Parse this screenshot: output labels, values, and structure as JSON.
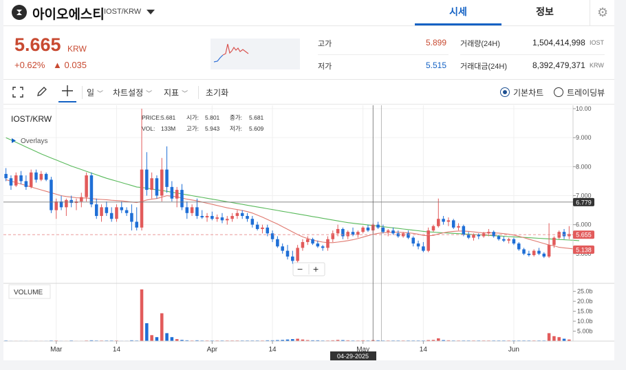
{
  "header": {
    "coin_name": "아이오에스티",
    "coin_pair": "IOST/KRW",
    "tabs": [
      "시세",
      "정보"
    ]
  },
  "summary": {
    "price": "5.665",
    "unit": "KRW",
    "change_rate": "+0.62%",
    "change_amount": "▲ 0.035",
    "high_label": "고가",
    "high": "5.899",
    "low_label": "저가",
    "low": "5.515",
    "volume_label": "거래량(24H)",
    "volume": "1,504,414,998",
    "volume_unit": "IOST",
    "value_label": "거래대금(24H)",
    "value": "8,392,479,371",
    "value_unit": "KRW"
  },
  "toolbar": {
    "period": "일",
    "chart_settings": "차트설정",
    "indicators": "지표",
    "reset": "초기화",
    "basic_chart": "기본차트",
    "trading_view": "트레이딩뷰"
  },
  "chart": {
    "symbol": "IOST/KRW",
    "overlays": "Overlays",
    "ohlc": {
      "price_label": "PRICE:",
      "price": "5.681",
      "open_label": "시가:",
      "open": "5.801",
      "close_label": "종가:",
      "close": "5.681",
      "vol_label": "VOL:",
      "vol": "133M",
      "high_label": "고가:",
      "high": "5.943",
      "low_label": "저가:",
      "low": "5.609"
    },
    "volume_title": "VOLUME",
    "cursor_date": "04-29-2025",
    "zoom_out": "−",
    "zoom_in": "+"
  },
  "chart_data": {
    "type": "candlestick",
    "x_ticks": [
      "Mar",
      "14",
      "Apr",
      "14",
      "May",
      "14",
      "Jun"
    ],
    "price_ticks": [
      10,
      9,
      8,
      7,
      6,
      5
    ],
    "price_tick_labels": [
      "10.00",
      "9.000",
      "8.000",
      "7.000",
      "6.000",
      "5.000"
    ],
    "volume_ticks": [
      25,
      20,
      15,
      10,
      5
    ],
    "volume_tick_labels": [
      "25.0b",
      "20.0b",
      "15.0b",
      "10.0b",
      "5.00b"
    ],
    "price_ylim": [
      4.0,
      10.0
    ],
    "volume_ylim": [
      0,
      28
    ],
    "price_markers": [
      {
        "label": "6.779",
        "value": 6.779,
        "color": "#333333"
      },
      {
        "label": "5.655",
        "value": 5.655,
        "color": "#e25b5b"
      },
      {
        "label": "5.138",
        "value": 5.138,
        "color": "#e25b5b"
      }
    ],
    "candles": [
      [
        7.75,
        7.95,
        7.5,
        7.6
      ],
      [
        7.6,
        7.7,
        7.2,
        7.35
      ],
      [
        7.35,
        7.8,
        7.3,
        7.7
      ],
      [
        7.7,
        7.85,
        7.4,
        7.5
      ],
      [
        7.5,
        7.7,
        7.2,
        7.3
      ],
      [
        7.3,
        7.9,
        7.25,
        7.8
      ],
      [
        7.8,
        7.9,
        7.45,
        7.55
      ],
      [
        7.55,
        7.85,
        7.5,
        7.75
      ],
      [
        7.75,
        7.8,
        7.5,
        7.55
      ],
      [
        7.55,
        7.65,
        6.4,
        6.5
      ],
      [
        6.5,
        6.9,
        6.2,
        6.8
      ],
      [
        6.8,
        7.0,
        6.5,
        6.6
      ],
      [
        6.6,
        6.9,
        6.3,
        6.85
      ],
      [
        6.85,
        7.0,
        6.6,
        6.75
      ],
      [
        6.75,
        6.9,
        6.5,
        6.8
      ],
      [
        6.8,
        7.1,
        6.6,
        6.95
      ],
      [
        6.95,
        7.8,
        6.8,
        7.7
      ],
      [
        7.7,
        7.8,
        6.6,
        6.7
      ],
      [
        6.7,
        6.9,
        6.2,
        6.3
      ],
      [
        6.3,
        6.7,
        6.1,
        6.6
      ],
      [
        6.6,
        6.8,
        6.3,
        6.4
      ],
      [
        6.4,
        6.6,
        6.1,
        6.2
      ],
      [
        6.2,
        6.7,
        6.1,
        6.6
      ],
      [
        6.6,
        6.8,
        6.4,
        6.5
      ],
      [
        6.5,
        6.6,
        6.3,
        6.4
      ],
      [
        6.4,
        6.7,
        5.8,
        6.1
      ],
      [
        6.1,
        6.6,
        5.8,
        5.9
      ],
      [
        5.9,
        10.0,
        5.8,
        7.9
      ],
      [
        7.9,
        8.5,
        7.0,
        7.2
      ],
      [
        7.2,
        7.8,
        6.9,
        7.6
      ],
      [
        7.6,
        7.7,
        6.9,
        7.0
      ],
      [
        7.0,
        8.3,
        6.8,
        7.9
      ],
      [
        7.9,
        8.7,
        7.1,
        7.3
      ],
      [
        7.3,
        7.5,
        6.8,
        6.9
      ],
      [
        6.9,
        7.3,
        6.6,
        7.2
      ],
      [
        7.2,
        7.4,
        6.5,
        6.6
      ],
      [
        6.6,
        6.8,
        6.2,
        6.4
      ],
      [
        6.4,
        6.7,
        6.3,
        6.6
      ],
      [
        6.6,
        6.9,
        6.2,
        6.3
      ],
      [
        6.3,
        6.5,
        6.2,
        6.25
      ],
      [
        6.25,
        6.4,
        6.1,
        6.3
      ],
      [
        6.3,
        6.45,
        6.15,
        6.2
      ],
      [
        6.2,
        6.35,
        6.1,
        6.25
      ],
      [
        6.25,
        6.4,
        6.05,
        6.15
      ],
      [
        6.15,
        6.3,
        6.0,
        6.2
      ],
      [
        6.2,
        6.4,
        6.1,
        6.3
      ],
      [
        6.3,
        6.5,
        6.2,
        6.4
      ],
      [
        6.4,
        6.5,
        6.2,
        6.3
      ],
      [
        6.3,
        6.4,
        6.1,
        6.2
      ],
      [
        6.2,
        6.3,
        5.9,
        6.0
      ],
      [
        6.0,
        6.1,
        5.8,
        5.85
      ],
      [
        5.85,
        6.0,
        5.7,
        5.9
      ],
      [
        5.9,
        6.0,
        5.6,
        5.7
      ],
      [
        5.7,
        5.8,
        5.4,
        5.5
      ],
      [
        5.5,
        5.6,
        5.2,
        5.25
      ],
      [
        5.25,
        5.35,
        5.0,
        5.1
      ],
      [
        5.1,
        5.3,
        4.8,
        4.9
      ],
      [
        4.9,
        5.1,
        4.65,
        4.75
      ],
      [
        4.75,
        5.3,
        4.7,
        5.2
      ],
      [
        5.2,
        5.5,
        5.1,
        5.4
      ],
      [
        5.4,
        5.6,
        5.3,
        5.5
      ],
      [
        5.5,
        5.55,
        5.3,
        5.35
      ],
      [
        5.35,
        5.45,
        5.2,
        5.25
      ],
      [
        5.25,
        5.3,
        5.1,
        5.2
      ],
      [
        5.2,
        5.6,
        5.1,
        5.5
      ],
      [
        5.5,
        5.8,
        5.4,
        5.7
      ],
      [
        5.7,
        6.0,
        5.6,
        5.85
      ],
      [
        5.85,
        5.9,
        5.5,
        5.6
      ],
      [
        5.6,
        5.8,
        5.5,
        5.75
      ],
      [
        5.75,
        5.9,
        5.6,
        5.65
      ],
      [
        5.65,
        5.8,
        5.55,
        5.75
      ],
      [
        5.75,
        5.95,
        5.7,
        5.9
      ],
      [
        5.9,
        6.0,
        5.75,
        5.8
      ],
      [
        5.8,
        6.05,
        5.7,
        6.0
      ],
      [
        6.0,
        6.1,
        5.85,
        5.9
      ],
      [
        5.9,
        6.0,
        5.7,
        5.75
      ],
      [
        5.75,
        5.85,
        5.6,
        5.8
      ],
      [
        5.8,
        5.9,
        5.65,
        5.7
      ],
      [
        5.7,
        5.8,
        5.55,
        5.6
      ],
      [
        5.6,
        5.75,
        5.55,
        5.7
      ],
      [
        5.7,
        5.8,
        5.5,
        5.55
      ],
      [
        5.55,
        5.6,
        5.25,
        5.35
      ],
      [
        5.35,
        5.45,
        5.15,
        5.25
      ],
      [
        5.25,
        5.4,
        5.05,
        5.1
      ],
      [
        5.1,
        5.9,
        5.05,
        5.8
      ],
      [
        5.8,
        6.0,
        5.75,
        5.95
      ],
      [
        5.95,
        6.9,
        5.9,
        6.2
      ],
      [
        6.2,
        6.3,
        6.0,
        6.1
      ],
      [
        6.1,
        6.25,
        5.95,
        6.15
      ],
      [
        6.15,
        6.2,
        5.85,
        5.9
      ],
      [
        5.9,
        6.05,
        5.8,
        5.95
      ],
      [
        5.95,
        6.0,
        5.6,
        5.65
      ],
      [
        5.65,
        5.75,
        5.5,
        5.55
      ],
      [
        5.55,
        5.7,
        5.45,
        5.65
      ],
      [
        5.65,
        5.7,
        5.5,
        5.6
      ],
      [
        5.6,
        5.75,
        5.55,
        5.7
      ],
      [
        5.7,
        5.85,
        5.6,
        5.75
      ],
      [
        5.75,
        5.8,
        5.55,
        5.6
      ],
      [
        5.6,
        5.65,
        5.45,
        5.5
      ],
      [
        5.5,
        5.6,
        5.4,
        5.45
      ],
      [
        5.45,
        5.55,
        5.35,
        5.5
      ],
      [
        5.5,
        5.55,
        5.3,
        5.35
      ],
      [
        5.35,
        5.4,
        5.1,
        5.15
      ],
      [
        5.15,
        5.2,
        4.95,
        5.0
      ],
      [
        5.0,
        5.1,
        4.9,
        4.95
      ],
      [
        4.95,
        5.15,
        4.9,
        5.1
      ],
      [
        5.1,
        5.2,
        4.95,
        5.0
      ],
      [
        5.0,
        5.05,
        4.85,
        4.9
      ],
      [
        4.9,
        6.05,
        4.85,
        5.3
      ],
      [
        5.3,
        5.6,
        5.2,
        5.55
      ],
      [
        5.55,
        5.8,
        5.5,
        5.75
      ],
      [
        5.75,
        5.85,
        5.5,
        5.6
      ],
      [
        5.6,
        5.95,
        5.5,
        5.68
      ]
    ],
    "volumes": [
      0.3,
      0.2,
      0.2,
      0.2,
      0.2,
      0.2,
      0.2,
      0.2,
      0.2,
      0.3,
      0.3,
      0.2,
      0.2,
      0.3,
      0.2,
      0.2,
      0.3,
      0.4,
      0.3,
      0.3,
      0.3,
      0.3,
      0.3,
      0.2,
      0.2,
      0.4,
      0.3,
      26.0,
      9.0,
      3.0,
      2.0,
      14.0,
      4.0,
      2.0,
      1.0,
      0.6,
      0.4,
      0.3,
      0.4,
      0.3,
      0.3,
      0.3,
      0.3,
      0.3,
      0.3,
      0.3,
      0.3,
      0.3,
      0.3,
      0.3,
      0.3,
      0.3,
      0.4,
      0.4,
      0.5,
      0.6,
      0.8,
      1.0,
      1.2,
      0.8,
      0.5,
      0.4,
      0.4,
      0.3,
      0.3,
      0.4,
      0.6,
      0.5,
      0.4,
      0.3,
      0.3,
      0.4,
      0.3,
      0.5,
      0.4,
      0.3,
      0.3,
      0.3,
      0.3,
      0.3,
      0.3,
      0.3,
      0.3,
      0.3,
      0.5,
      0.6,
      1.4,
      0.5,
      0.4,
      0.3,
      0.3,
      0.3,
      0.3,
      0.3,
      0.3,
      0.3,
      0.3,
      0.3,
      0.3,
      0.3,
      0.3,
      0.3,
      0.3,
      0.3,
      0.3,
      0.3,
      0.3,
      0.3,
      4.0,
      2.5,
      2.0,
      1.2,
      0.8
    ],
    "ma_red": [
      7.55,
      7.5,
      7.45,
      7.4,
      7.35,
      7.3,
      7.25,
      7.2,
      7.15,
      7.1,
      7.05,
      7.0,
      6.97,
      6.95,
      6.93,
      6.92,
      6.92,
      6.9,
      6.88,
      6.87,
      6.86,
      6.84,
      6.83,
      6.82,
      6.8,
      6.78,
      6.76,
      6.8,
      6.85,
      6.88,
      6.9,
      6.95,
      7.0,
      6.98,
      6.96,
      6.92,
      6.88,
      6.85,
      6.82,
      6.78,
      6.74,
      6.7,
      6.66,
      6.62,
      6.58,
      6.55,
      6.52,
      6.49,
      6.45,
      6.4,
      6.33,
      6.26,
      6.18,
      6.1,
      6.02,
      5.93,
      5.84,
      5.75,
      5.66,
      5.58,
      5.52,
      5.47,
      5.43,
      5.4,
      5.38,
      5.38,
      5.4,
      5.42,
      5.45,
      5.48,
      5.52,
      5.57,
      5.62,
      5.67,
      5.7,
      5.72,
      5.73,
      5.74,
      5.74,
      5.73,
      5.72,
      5.7,
      5.67,
      5.63,
      5.62,
      5.63,
      5.68,
      5.72,
      5.75,
      5.77,
      5.78,
      5.78,
      5.77,
      5.75,
      5.73,
      5.72,
      5.72,
      5.72,
      5.71,
      5.69,
      5.67,
      5.64,
      5.6,
      5.55,
      5.5,
      5.45,
      5.4,
      5.35,
      5.3,
      5.27,
      5.22,
      5.2,
      5.18,
      5.16,
      5.14
    ],
    "ma_green": [
      9.0,
      8.92,
      8.84,
      8.76,
      8.68,
      8.6,
      8.52,
      8.44,
      8.37,
      8.3,
      8.23,
      8.16,
      8.09,
      8.02,
      7.96,
      7.9,
      7.84,
      7.78,
      7.72,
      7.66,
      7.6,
      7.55,
      7.5,
      7.45,
      7.4,
      7.35,
      7.3,
      7.28,
      7.26,
      7.23,
      7.2,
      7.18,
      7.15,
      7.12,
      7.09,
      7.06,
      7.03,
      7.0,
      6.97,
      6.94,
      6.91,
      6.88,
      6.85,
      6.82,
      6.79,
      6.76,
      6.73,
      6.7,
      6.67,
      6.64,
      6.61,
      6.58,
      6.55,
      6.52,
      6.49,
      6.46,
      6.43,
      6.4,
      6.37,
      6.34,
      6.31,
      6.28,
      6.25,
      6.22,
      6.19,
      6.16,
      6.13,
      6.1,
      6.07,
      6.05,
      6.03,
      6.01,
      5.99,
      5.97,
      5.95,
      5.93,
      5.91,
      5.89,
      5.87,
      5.85,
      5.83,
      5.81,
      5.79,
      5.77,
      5.75,
      5.74,
      5.73,
      5.72,
      5.71,
      5.7,
      5.69,
      5.68,
      5.67,
      5.66,
      5.65,
      5.64,
      5.63,
      5.62,
      5.61,
      5.6,
      5.59,
      5.58,
      5.57,
      5.56,
      5.55,
      5.54,
      5.53,
      5.52,
      5.51,
      5.5,
      5.49,
      5.48,
      5.47,
      5.46,
      5.45
    ]
  }
}
